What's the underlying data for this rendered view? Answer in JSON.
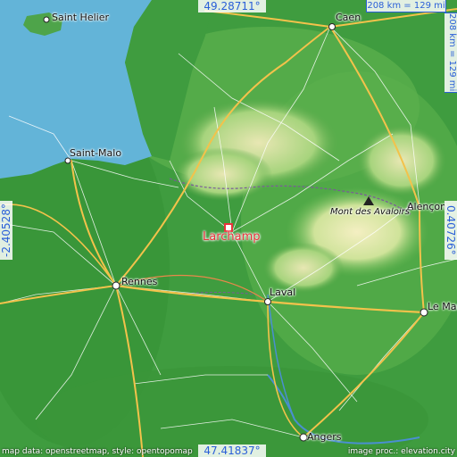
{
  "map": {
    "coordinates": {
      "top": "49.28711°",
      "bottom": "47.41837°",
      "left": "-2.40528°",
      "right": "0.40726°"
    },
    "scale": {
      "horizontal": "208 km = 129 mi",
      "vertical": "208 km = 129 mi"
    },
    "main_place": "Larchamp",
    "cities": [
      {
        "name": "Saint Helier"
      },
      {
        "name": "Caen"
      },
      {
        "name": "Saint-Malo"
      },
      {
        "name": "Alençon"
      },
      {
        "name": "Mont des Avaloirs"
      },
      {
        "name": "Rennes"
      },
      {
        "name": "Laval"
      },
      {
        "name": "Le Mans"
      },
      {
        "name": "Angers"
      }
    ],
    "attribution": {
      "left": "map data: openstreetmap, style: opentopomap",
      "right": "image proc.: elevation.city"
    },
    "colors": {
      "sea": "#63b4d8",
      "lowland": "#3d9a3d",
      "highland": "#f2eec0",
      "marker": "#e8333b",
      "label_blue": "#2a5fd8"
    }
  }
}
